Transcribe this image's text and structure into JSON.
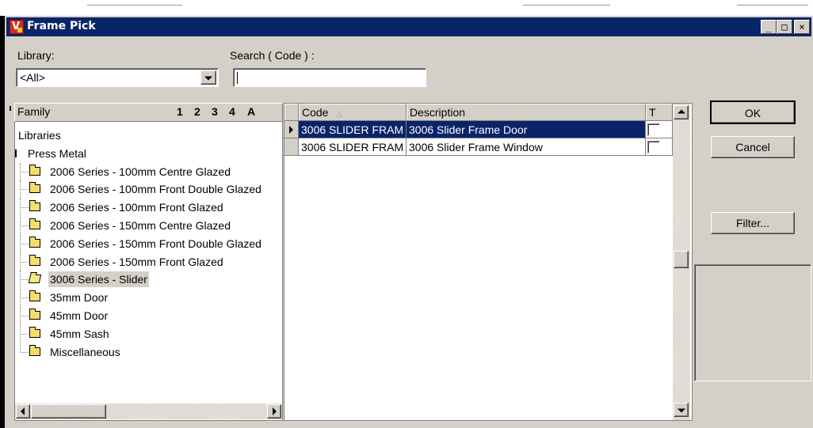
{
  "window": {
    "title": "Frame Pick",
    "app_icon_letter": "V"
  },
  "caption_buttons": {
    "minimize": "_",
    "maximize": "□",
    "close": "×"
  },
  "filters": {
    "library_label": "Library:",
    "library_value": "<All>",
    "search_label": "Search ( Code ) :",
    "search_value": ""
  },
  "tree": {
    "header_label": "Family",
    "header_numbers": [
      "1",
      "2",
      "3",
      "4",
      "A"
    ],
    "items": [
      {
        "label": "Libraries",
        "level": 0,
        "icon": "none"
      },
      {
        "label": "Press Metal",
        "level": 1,
        "icon": "none"
      },
      {
        "label": "2006 Series - 100mm Centre Glazed",
        "level": 2,
        "icon": "folder-icon"
      },
      {
        "label": "2006 Series - 100mm Front Double Glazed",
        "level": 2,
        "icon": "folder-icon"
      },
      {
        "label": "2006 Series - 100mm Front Glazed",
        "level": 2,
        "icon": "folder-icon"
      },
      {
        "label": "2006 Series - 150mm Centre Glazed",
        "level": 2,
        "icon": "folder-icon"
      },
      {
        "label": "2006 Series - 150mm Front Double Glazed",
        "level": 2,
        "icon": "folder-icon"
      },
      {
        "label": "2006 Series - 150mm Front Glazed",
        "level": 2,
        "icon": "folder-icon"
      },
      {
        "label": "3006 Series - Slider",
        "level": 2,
        "icon": "folder-open-icon",
        "selected": true
      },
      {
        "label": "35mm Door",
        "level": 2,
        "icon": "folder-icon"
      },
      {
        "label": "45mm Door",
        "level": 2,
        "icon": "folder-icon"
      },
      {
        "label": "45mm Sash",
        "level": 2,
        "icon": "folder-icon"
      },
      {
        "label": "Miscellaneous",
        "level": 2,
        "icon": "folder-icon"
      }
    ]
  },
  "grid": {
    "columns": [
      "Code",
      "Description",
      "T"
    ],
    "rows": [
      {
        "code": "3006 SLIDER FRAM",
        "description": "3006 Slider Frame Door",
        "selected": true
      },
      {
        "code": "3006 SLIDER FRAM",
        "description": "3006 Slider Frame Window",
        "selected": false
      }
    ]
  },
  "buttons": {
    "ok": "OK",
    "cancel": "Cancel",
    "filter": "Filter..."
  },
  "colors": {
    "titlebar": "#0a246a",
    "face": "#d4d0c8",
    "selection": "#0a246a"
  }
}
